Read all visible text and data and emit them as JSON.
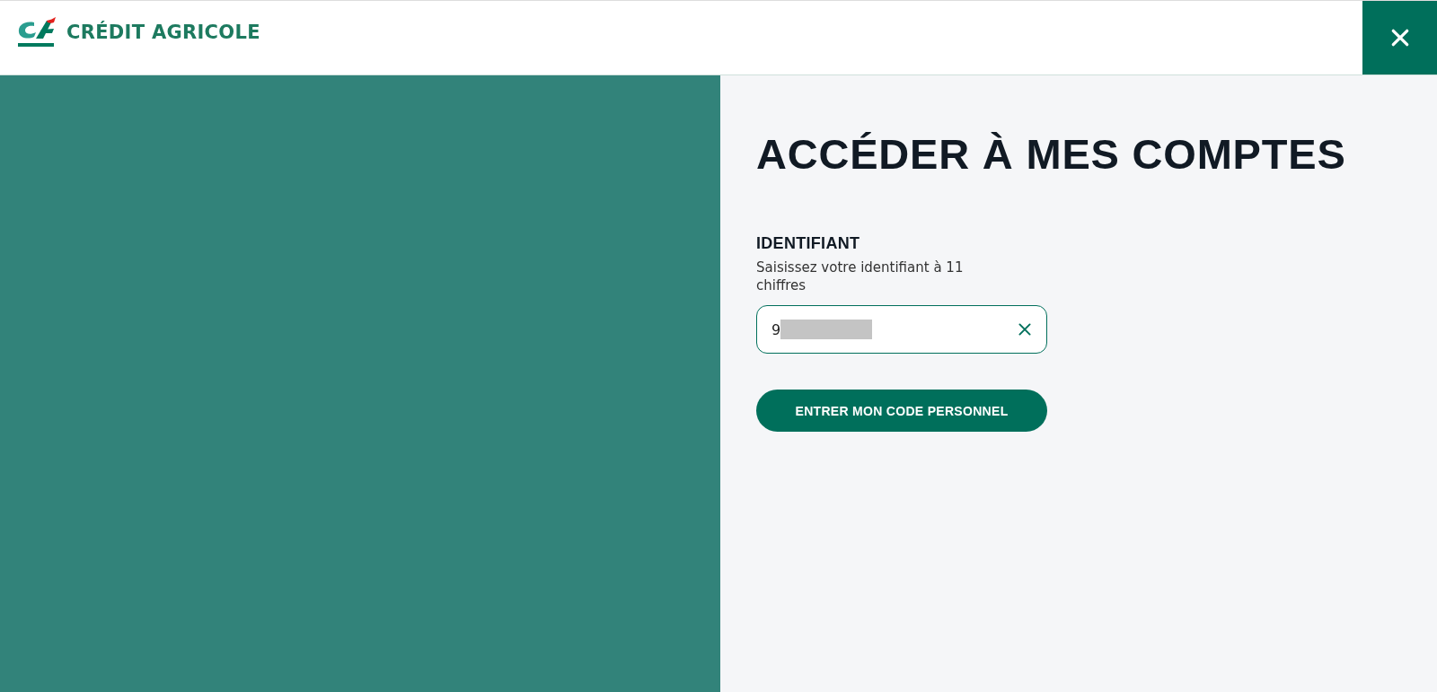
{
  "header": {
    "brand": "CRÉDIT AGRICOLE"
  },
  "login": {
    "title": "ACCÉDER À MES COMPTES",
    "field": {
      "label": "IDENTIFIANT",
      "hint": "Saisissez votre identifiant à 11 chiffres",
      "value": "9",
      "masked": true
    },
    "button": "ENTRER MON CODE PERSONNEL"
  }
}
